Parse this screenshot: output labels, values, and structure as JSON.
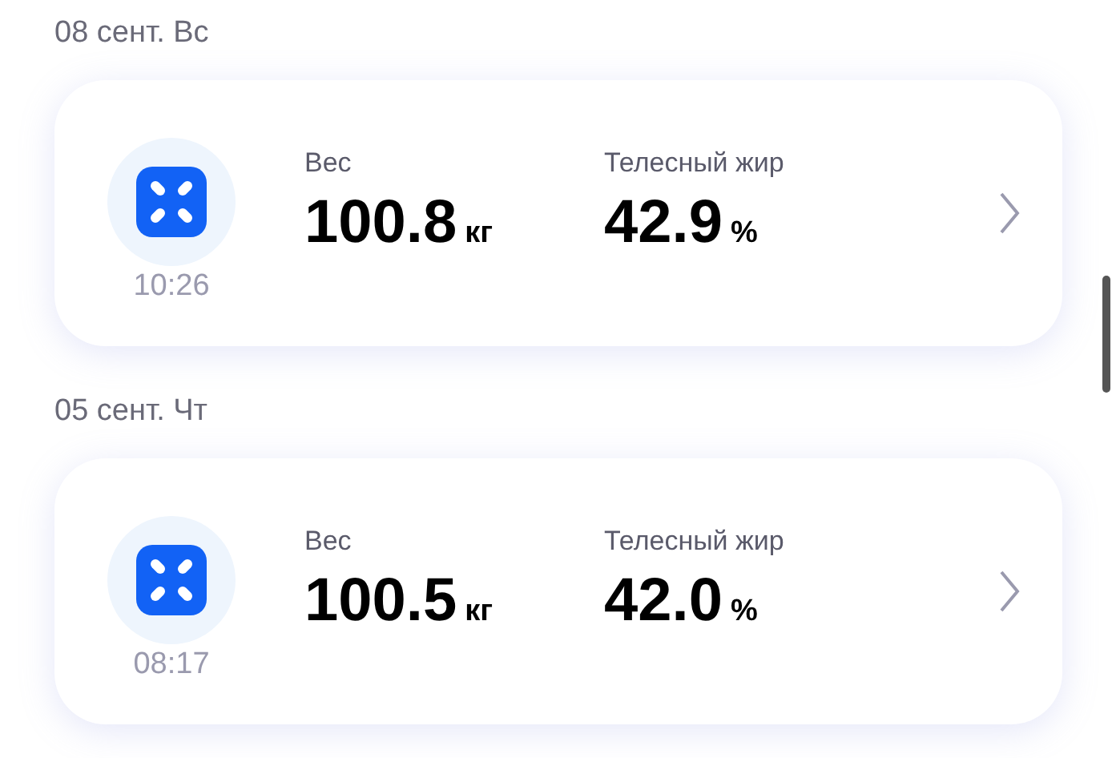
{
  "entries": [
    {
      "date": "08 сент. Вс",
      "time": "10:26",
      "metrics": [
        {
          "label": "Вес",
          "value": "100.8",
          "unit": "кг"
        },
        {
          "label": "Телесный жир",
          "value": "42.9",
          "unit": "%"
        }
      ]
    },
    {
      "date": "05 сент. Чт",
      "time": "08:17",
      "metrics": [
        {
          "label": "Вес",
          "value": "100.5",
          "unit": "кг"
        },
        {
          "label": "Телесный жир",
          "value": "42.0",
          "unit": "%"
        }
      ]
    }
  ]
}
